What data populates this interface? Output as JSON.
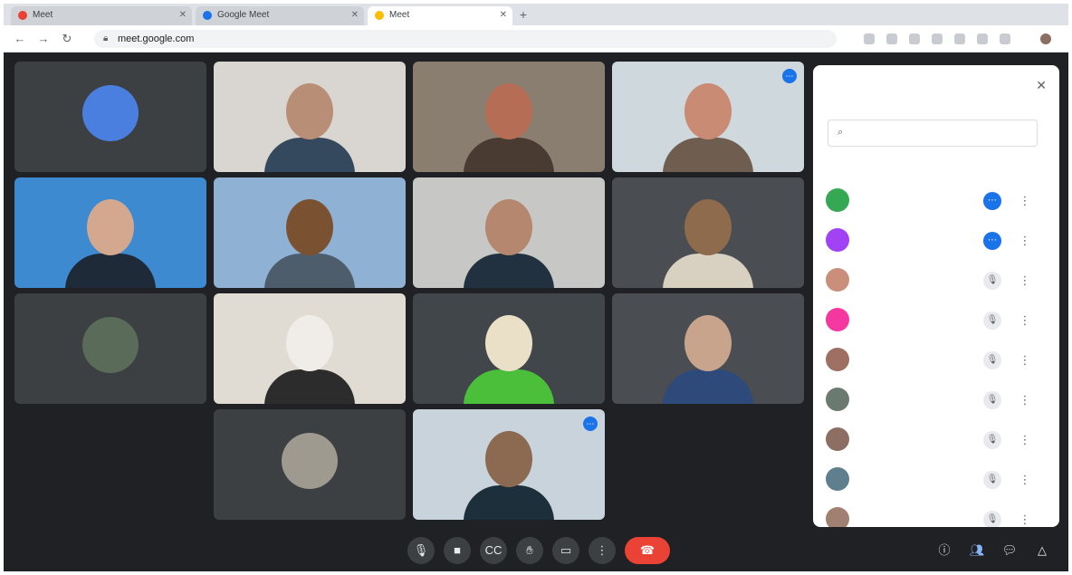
{
  "browser": {
    "tabs": [
      {
        "title": "Meet",
        "favicon_color": "#ea4335",
        "active": false
      },
      {
        "title": "Google Meet",
        "favicon_color": "#1a73e8",
        "active": false
      },
      {
        "title": "Meet",
        "favicon_color": "#fbbc04",
        "active": true
      }
    ],
    "new_tab_icon": "plus-icon",
    "url": "meet.google.com"
  },
  "tiles": [
    {
      "name": "",
      "type": "avatar",
      "color": "#4a7fe0",
      "initial": ""
    },
    {
      "name": "",
      "type": "video",
      "bg": "#d9d6d2",
      "skin": "#b98e76",
      "shirt": "#34495e"
    },
    {
      "name": "",
      "type": "video",
      "bg": "#8a7e70",
      "skin": "#b56d55",
      "shirt": "#4a3b32"
    },
    {
      "name": "",
      "type": "video",
      "bg": "#cfd8dc",
      "skin": "#c98b73",
      "shirt": "#6f5e50"
    },
    {
      "name": "",
      "type": "video",
      "bg": "#3d8ad1",
      "skin": "#d4a78f",
      "shirt": "#1e2a38"
    },
    {
      "name": "",
      "type": "video",
      "bg": "#8fb1d3",
      "skin": "#7a5232",
      "shirt": "#4d5d6b"
    },
    {
      "name": "",
      "type": "video",
      "bg": "#c7c7c5",
      "skin": "#b5876f",
      "shirt": "#22313f"
    },
    {
      "name": "",
      "type": "video",
      "bg": "#4a4d51",
      "skin": "#8e6b4c",
      "shirt": "#d8d0c0"
    },
    {
      "name": "",
      "type": "avatar",
      "color": "#5b6b5a",
      "initial": ""
    },
    {
      "name": "",
      "type": "video",
      "bg": "#e0dcd4",
      "skin": "#f0ede8",
      "shirt": "#2c2c2c"
    },
    {
      "name": "",
      "type": "video",
      "bg": "#41464b",
      "skin": "#e9e0c7",
      "shirt": "#4bbf3a"
    },
    {
      "name": "",
      "type": "video",
      "bg": "#4a4d51",
      "skin": "#c9a48d",
      "shirt": "#2e4a7a"
    },
    {
      "name": "",
      "type": "avatar",
      "color": "#9e9a90",
      "initial": ""
    },
    {
      "name": "",
      "type": "video",
      "bg": "#c9d3dc",
      "skin": "#8c6a52",
      "shirt": "#1d2f3a"
    }
  ],
  "panel": {
    "title": "",
    "close_icon": "close-icon",
    "search_placeholder": "",
    "section_label": "",
    "participants": [
      {
        "name": "",
        "color": "#34a853",
        "mic_active": true
      },
      {
        "name": "",
        "color": "#a142f4",
        "mic_active": true
      },
      {
        "name": "",
        "color": "#c98f7a",
        "mic_active": false
      },
      {
        "name": "",
        "color": "#f538a0",
        "mic_active": false
      },
      {
        "name": "",
        "color": "#9e7063",
        "mic_active": false
      },
      {
        "name": "",
        "color": "#6b7a70",
        "mic_active": false
      },
      {
        "name": "",
        "color": "#8d6e63",
        "mic_active": false
      },
      {
        "name": "",
        "color": "#5f7f8f",
        "mic_active": false
      },
      {
        "name": "",
        "color": "#a08070",
        "mic_active": false
      }
    ]
  },
  "bottom": {
    "time_code": "",
    "controls": [
      "mic-icon",
      "camera-icon",
      "captions-icon",
      "raise-hand-icon",
      "present-icon",
      "more-icon"
    ],
    "hangup_icon": "hangup-icon",
    "side_controls": [
      "info-icon",
      "people-icon",
      "chat-icon",
      "activities-icon"
    ],
    "accent": "#8ab4f8",
    "hangup_color": "#ea4335"
  }
}
